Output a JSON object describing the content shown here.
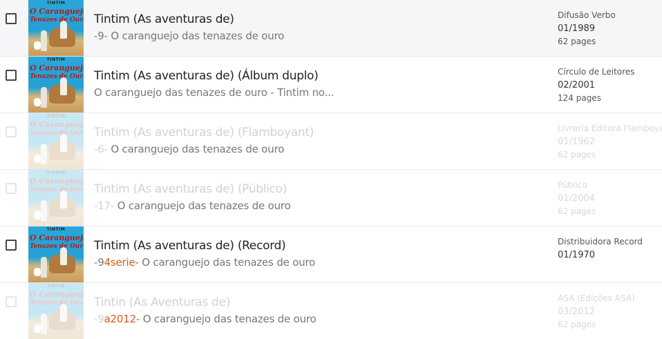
{
  "rows": [
    {
      "title": "Tintim (As aventuras de)",
      "num": "-9-",
      "suffix": "",
      "subtitle": " O caranguejo das tenazes de ouro",
      "publisher": "Difusão Verbo",
      "date": "01/1989",
      "pages": "62 pages",
      "disabled": false,
      "cover": {
        "top": "TINTIM",
        "line1": "O Caranguejo das",
        "line2": "Tenazes de Ouro",
        "icon": "album-cover-image"
      }
    },
    {
      "title": "Tintim (As aventuras de) (Álbum duplo)",
      "num": "",
      "suffix": "",
      "subtitle": "O caranguejo das tenazes de ouro - Tintim no...",
      "publisher": "Círculo de Leitores",
      "date": "02/2001",
      "pages": "124 pages",
      "disabled": false,
      "cover": {
        "top": "TINTIM",
        "line1": "O Caranguejo das",
        "line2": "Tenazes de Ouro",
        "icon": "album-cover-image"
      }
    },
    {
      "title": "Tintim (As aventuras de) (Flamboyant)",
      "num": "-6-",
      "suffix": "",
      "subtitle": " O caranguejo das tenazes de ouro",
      "publisher": "Livraria Editora Flamboyant",
      "date": "01/1962",
      "pages": "62 pages",
      "disabled": true,
      "cover": {
        "top": "TINTIM",
        "line1": "O Caranguejo das",
        "line2": "Tenazes de Ouro",
        "icon": "album-cover-image"
      }
    },
    {
      "title": "Tintim (As aventuras de) (Público)",
      "num": "-17-",
      "suffix": "",
      "subtitle": " O caranguejo das tenazes de ouro",
      "publisher": "Público",
      "date": "01/2004",
      "pages": "62 pages",
      "disabled": true,
      "cover": {
        "top": "TINTIM",
        "line1": "O Caranguejo das",
        "line2": "Tenazes de Ouro",
        "icon": "album-cover-image"
      }
    },
    {
      "title": "Tintim (As aventuras de) (Record)",
      "num": "-9",
      "suffix": "4serie",
      "subtitle": "- O caranguejo das tenazes de ouro",
      "publisher": "Distribuidora Record",
      "date": "01/1970",
      "pages": "",
      "disabled": false,
      "cover": {
        "top": "TINTIM",
        "line1": "O Caranguejo das",
        "line2": "Tenazes de Ouro",
        "icon": "album-cover-image"
      }
    },
    {
      "title": "Tintin (As Aventuras de)",
      "num": "-9",
      "suffix": "a2012",
      "subtitle": "- O caranguejo das tenazes de ouro",
      "publisher": "ASA (Edições ASA)",
      "date": "03/2012",
      "pages": "62 pages",
      "disabled": true,
      "cover": {
        "top": "TINTIN",
        "line1": "O Caranguejo das",
        "line2": "Tenazes de Ouro",
        "icon": "album-cover-image"
      }
    }
  ],
  "colors": {
    "suffix_accent": "#d35a1f",
    "row_highlight": "#f5f6f7"
  }
}
